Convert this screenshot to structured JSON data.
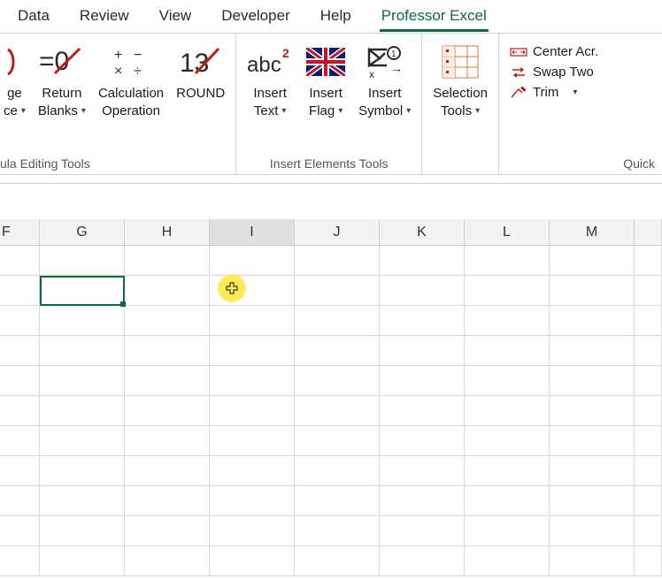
{
  "tabs": {
    "data": "Data",
    "review": "Review",
    "view": "View",
    "developer": "Developer",
    "help": "Help",
    "professor_excel": "Professor Excel"
  },
  "ribbon": {
    "group1": {
      "btn_ge_1": "ge",
      "btn_ge_2": "ce",
      "btn_return_1": "Return",
      "btn_return_2": "Blanks",
      "btn_calc_1": "Calculation",
      "btn_calc_2": "Operation",
      "btn_round": "ROUND",
      "label": "ula Editing Tools"
    },
    "group2": {
      "btn_insert_text_1": "Insert",
      "btn_insert_text_2": "Text",
      "btn_insert_flag_1": "Insert",
      "btn_insert_flag_2": "Flag",
      "btn_insert_symbol_1": "Insert",
      "btn_insert_symbol_2": "Symbol",
      "label": "Insert Elements Tools"
    },
    "group3": {
      "btn_selection_1": "Selection",
      "btn_selection_2": "Tools",
      "label": ""
    },
    "group4": {
      "btn_center": "Center Acr.",
      "btn_swap": "Swap Two",
      "btn_trim": "Trim",
      "label": "Quick"
    }
  },
  "columns": [
    "F",
    "G",
    "H",
    "I",
    "J",
    "K",
    "L",
    "M"
  ],
  "selected_cell": "G3",
  "hover_cell": "I3"
}
